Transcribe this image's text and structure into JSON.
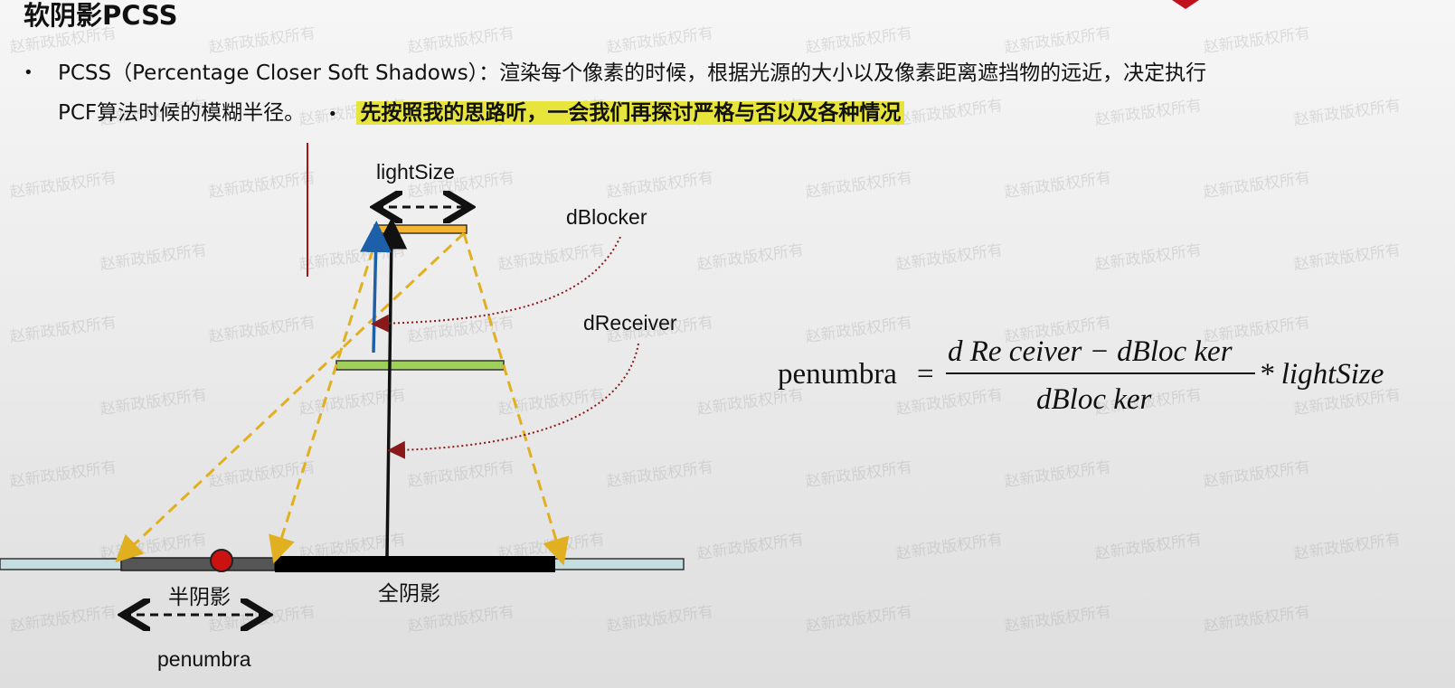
{
  "slide": {
    "title": "软阴影PCSS",
    "bullet_marker": "•",
    "bullet_line1": "PCSS（Percentage Closer Soft Shadows）：渲染每个像素的时候，根据光源的大小以及像素距离遮挡物的远近，决定执行",
    "bullet_line2": "PCF算法时候的模糊半径。",
    "inline_marker": "•",
    "highlight": "先按照我的思路听，一会我们再探讨严格与否以及各种情况"
  },
  "diagram": {
    "labels": {
      "light_size": "lightSize",
      "d_blocker": "dBlocker",
      "d_receiver": "dReceiver",
      "penumbra_zh": "半阴影",
      "umbra_zh": "全阴影",
      "penumbra": "penumbra"
    },
    "colors": {
      "light_bar": "#f2b431",
      "dashed_rays": "#e0b020",
      "occluder": "#9ed05a",
      "blue_arrow": "#1d5fa8",
      "dotted_arrows": "#8a1a1a",
      "red_line": "#b01010",
      "umbra": "#000000",
      "penumbra_region": "#555555",
      "receiver_plane": "#c6dde0",
      "red_dot": "#cc1111"
    }
  },
  "formula": {
    "lhs": "penumbra",
    "equals": "=",
    "numerator": "d Re ceiver − dBloc ker",
    "denominator": "dBloc ker",
    "multiplier": "* lightSize"
  },
  "watermark": {
    "text": "赵新政版权所有"
  }
}
